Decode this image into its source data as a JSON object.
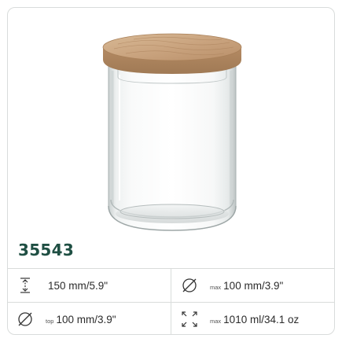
{
  "product": {
    "sku": "35543",
    "image_alt": "Glass jar with wooden lid"
  },
  "specs": [
    {
      "icon": "height-icon",
      "prefix": "",
      "value": "150 mm/5.9\""
    },
    {
      "icon": "diameter-icon",
      "prefix": "max",
      "value": "100 mm/3.9\""
    },
    {
      "icon": "diameter-icon",
      "prefix": "top",
      "value": "100 mm/3.9\""
    },
    {
      "icon": "volume-icon",
      "prefix": "max",
      "value": "1010 ml/34.1 oz"
    }
  ],
  "colors": {
    "sku_text": "#1f4f43",
    "border": "#d9dcdb",
    "lid_wood": "#c9a27e"
  }
}
